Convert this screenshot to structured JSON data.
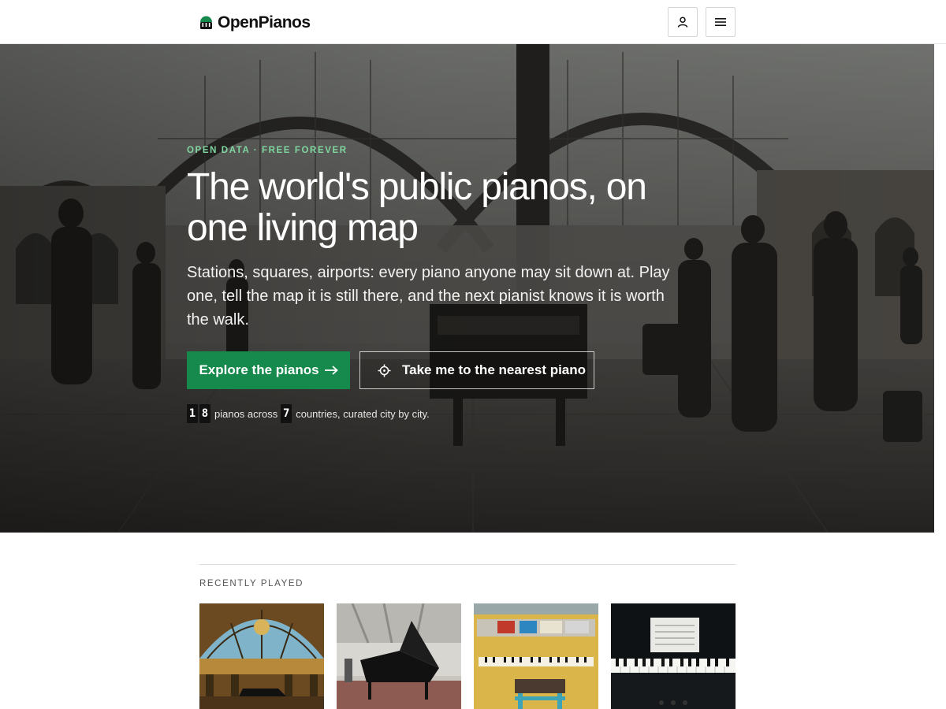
{
  "header": {
    "logo_text": "OpenPianos",
    "account_icon": "person-icon",
    "menu_icon": "hamburger-menu-icon"
  },
  "hero": {
    "eyebrow": "OPEN DATA · FREE FOREVER",
    "title": "The world's public pianos, on one living map",
    "subtitle": "Stations, squares, airports: every piano anyone may sit down at. Play one, tell the map it is still there, and the next pianist knows it is worth the walk.",
    "primary_button": {
      "label": "Explore the pianos",
      "icon": "arrow-right-icon"
    },
    "secondary_button": {
      "label": "Take me to the nearest piano",
      "icon": "crosshair-icon"
    },
    "stats": {
      "piano_digits": [
        "1",
        "8"
      ],
      "pianos_text": "pianos across",
      "country_digits": [
        "7"
      ],
      "countries_text": "countries, curated city by city."
    }
  },
  "recently_played": {
    "label": "RECENTLY PLAYED",
    "cards": [
      {
        "name": "grand-piano-under-glass-dome"
      },
      {
        "name": "grand-piano-in-terminal"
      },
      {
        "name": "painted-yellow-upright-piano"
      },
      {
        "name": "black-upright-piano-keys"
      }
    ]
  },
  "colors": {
    "accent_green": "#16894c",
    "eyebrow_green": "#7fd6a0",
    "header_border": "#e4e4e4"
  }
}
